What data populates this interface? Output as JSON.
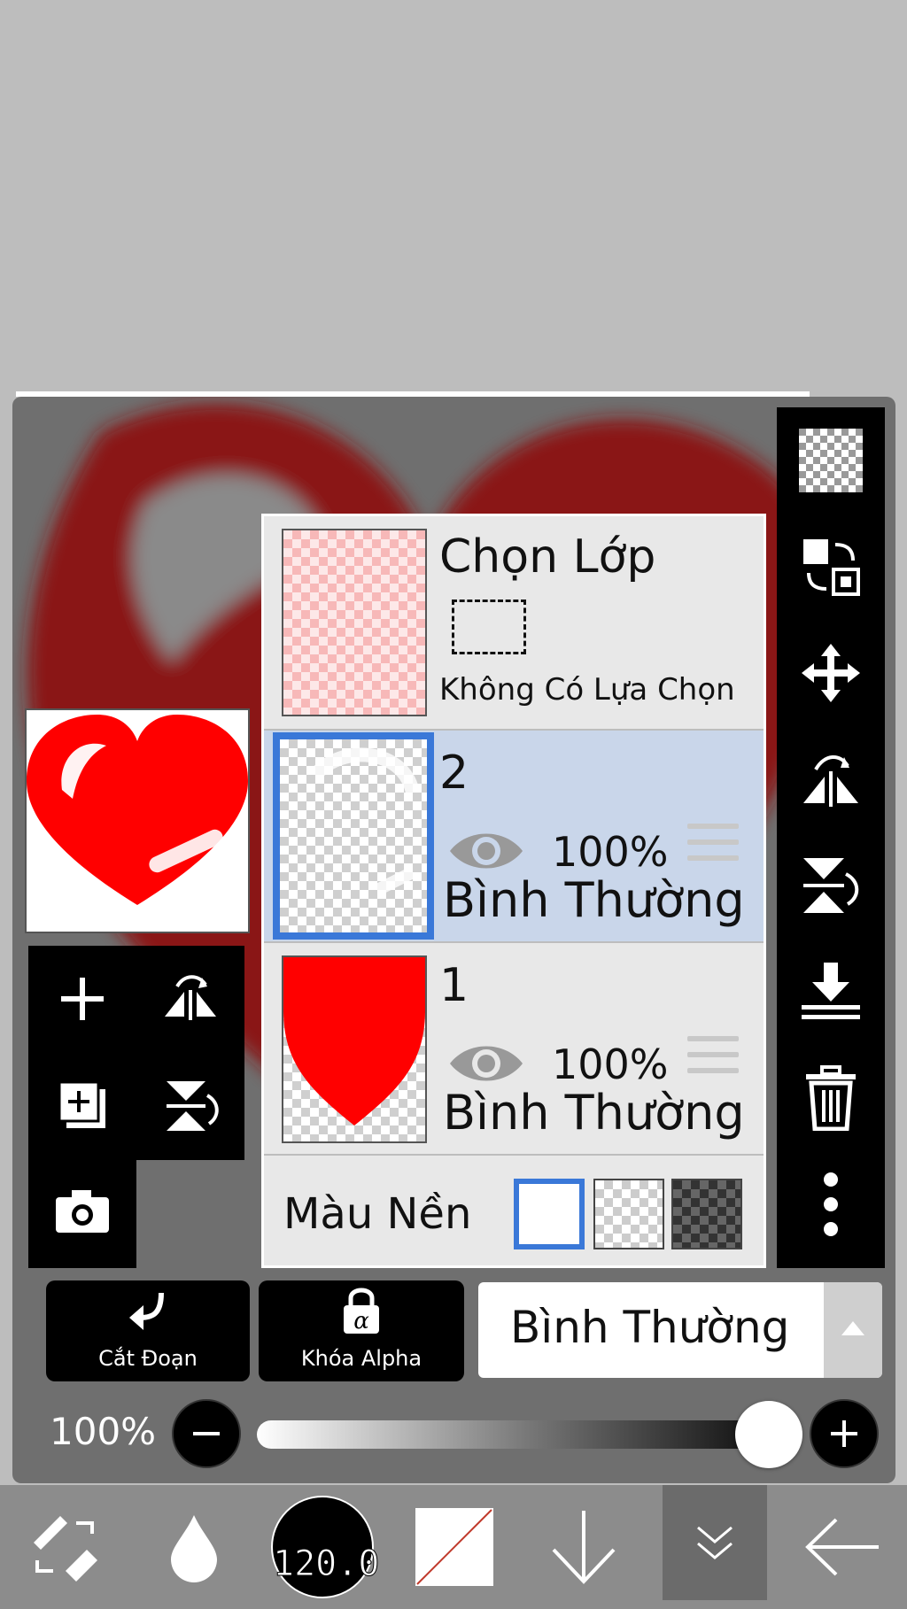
{
  "layer_panel": {
    "selection_layer": {
      "title": "Chọn Lớp",
      "subtitle": "Không Có Lựa Chọn"
    },
    "layers": [
      {
        "name": "2",
        "opacity": "100%",
        "blend": "Bình Thường",
        "selected": true
      },
      {
        "name": "1",
        "opacity": "100%",
        "blend": "Bình Thường",
        "selected": false
      }
    ],
    "background_label": "Màu Nền"
  },
  "controls": {
    "clipping_label": "Cắt Đoạn",
    "alpha_lock_label": "Khóa Alpha",
    "blend_mode_value": "Bình Thường",
    "opacity_value": "100%"
  },
  "toolbar": {
    "brush_size": "120.0"
  },
  "colors": {
    "accent": "#3a78d8",
    "heart": "#ff0000",
    "selected_row": "#c9d6ea"
  },
  "icons": {
    "right_tools": [
      "transparency-icon",
      "swap-layers-icon",
      "move-icon",
      "flip-horizontal-icon",
      "flip-vertical-icon",
      "merge-down-icon",
      "trash-icon",
      "more-icon"
    ],
    "left_tools": [
      "add-layer-icon",
      "flip-horizontal-icon",
      "duplicate-layer-icon",
      "flip-vertical-icon",
      "camera-icon"
    ],
    "toolbar": [
      "brush-eraser-toggle-icon",
      "blur-drop-icon",
      "brush-size-icon",
      "color-swatch-icon",
      "download-arrow-icon",
      "collapse-icon",
      "back-arrow-icon"
    ]
  }
}
